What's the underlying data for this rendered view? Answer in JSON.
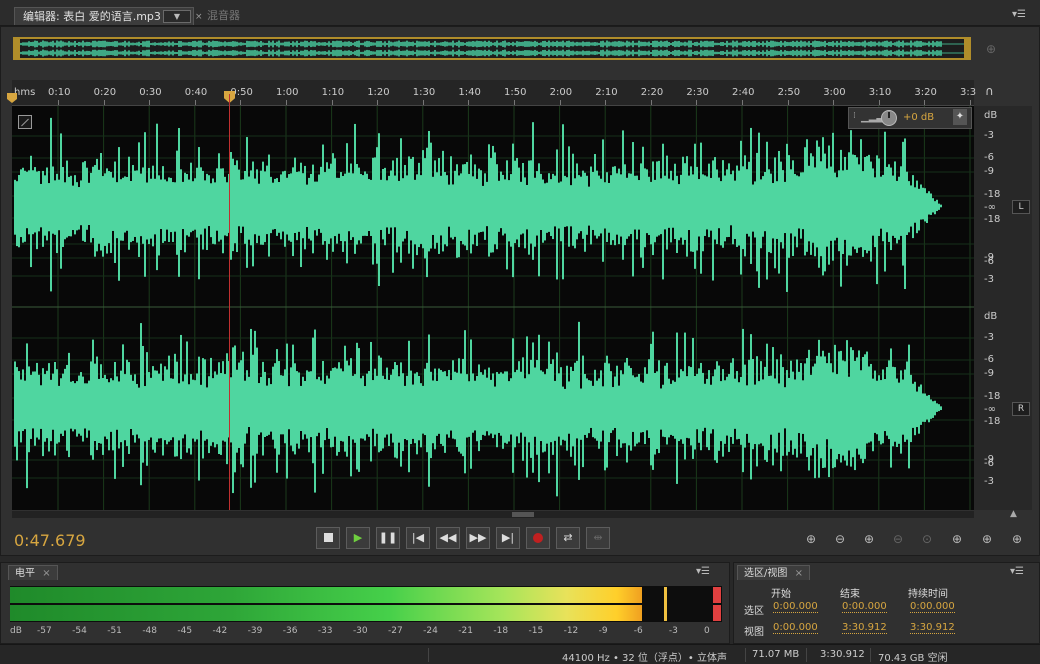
{
  "editor_tab": {
    "label": "编辑器: 表白 爱的语言.mp3",
    "dropdown": "▼",
    "close": "×",
    "mixer_tab": "混音器"
  },
  "ruler": {
    "unit": "hms",
    "ticks": [
      "0:10",
      "0:20",
      "0:30",
      "0:40",
      "0:50",
      "1:00",
      "1:10",
      "1:20",
      "1:30",
      "1:40",
      "1:50",
      "2:00",
      "2:10",
      "2:20",
      "2:30",
      "2:40",
      "2:50",
      "3:00",
      "3:10",
      "3:20",
      "3:3"
    ]
  },
  "gain": {
    "value": "+0 dB"
  },
  "db_scale": {
    "label": "dB",
    "upper_values": [
      "-3",
      "-6",
      "-9",
      "-18",
      "-∞",
      "-18",
      "-9",
      "-6",
      "-3"
    ],
    "channel_left": "L",
    "channel_right": "R"
  },
  "transport": {
    "current_time": "0:47.679",
    "playhead_position": "0:47.679"
  },
  "levels_panel": {
    "tab_label": "电平",
    "close": "×",
    "scale_unit": "dB",
    "scale": [
      "-57",
      "-54",
      "-51",
      "-48",
      "-45",
      "-42",
      "-39",
      "-36",
      "-33",
      "-30",
      "-27",
      "-24",
      "-21",
      "-18",
      "-15",
      "-12",
      "-9",
      "-6",
      "-3",
      "0"
    ],
    "level_left_fraction": 0.903,
    "level_right_fraction": 0.903
  },
  "selection_view_panel": {
    "tab_label": "选区/视图",
    "close": "×",
    "col_start": "开始",
    "col_end": "结束",
    "col_duration": "持续时间",
    "row_selection": "选区",
    "row_view": "视图",
    "selection_start": "0:00.000",
    "selection_end": "0:00.000",
    "selection_duration": "0:00.000",
    "view_start": "0:00.000",
    "view_end": "3:30.912",
    "view_duration": "3:30.912"
  },
  "status_bar": {
    "format": "44100 Hz • 32 位（浮点）• 立体声",
    "file_size": "71.07 MB",
    "duration": "3:30.912",
    "free_space": "70.43 GB 空闲"
  },
  "colors": {
    "waveform": "#4fd6a0",
    "accent_time": "#d7a640",
    "playhead": "#c03030"
  }
}
